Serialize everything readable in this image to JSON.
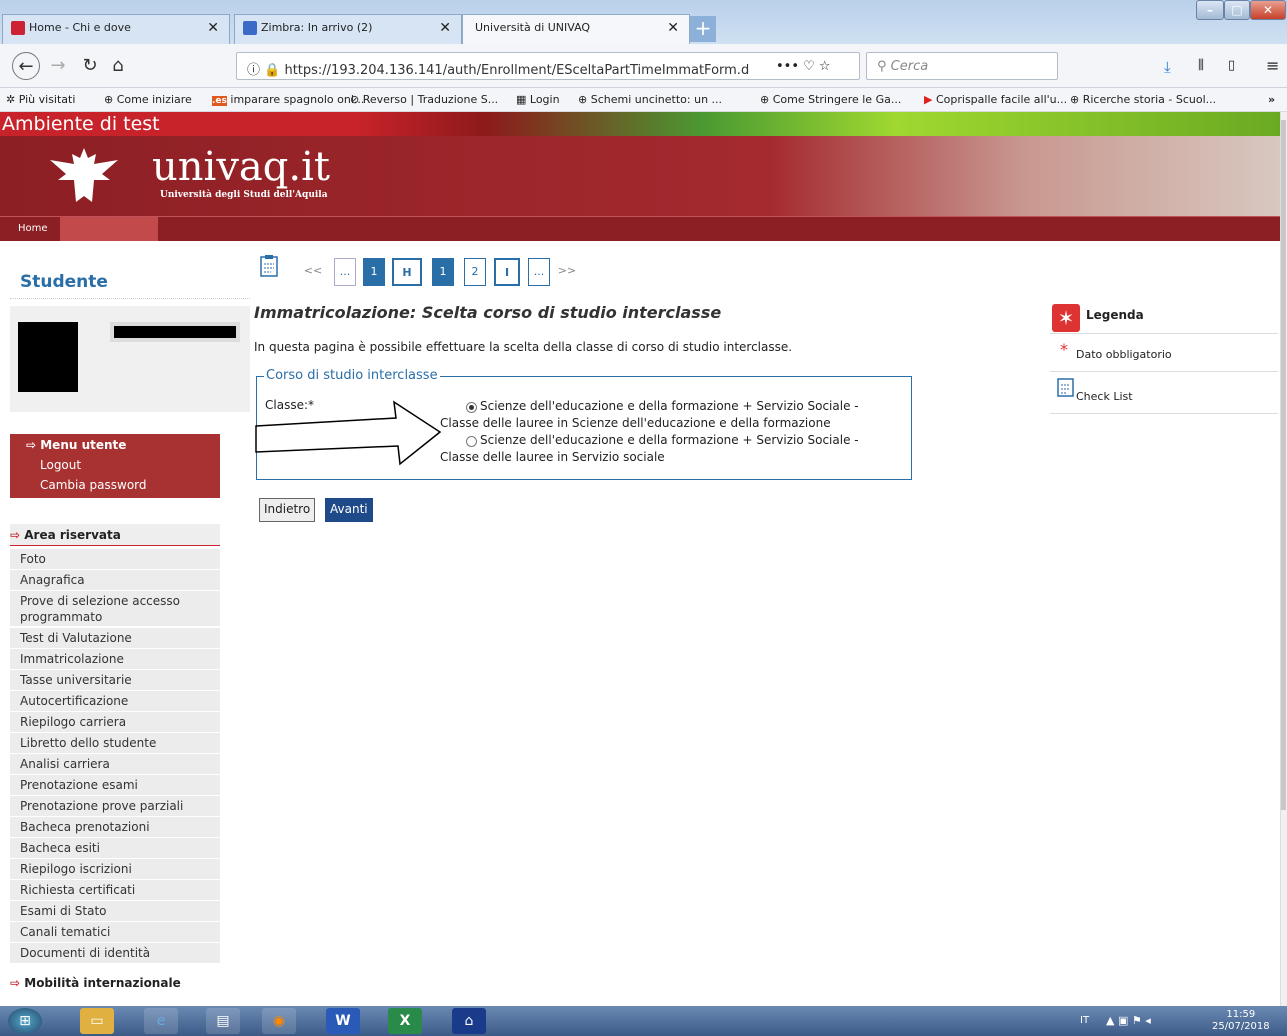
{
  "browser": {
    "tabs": [
      {
        "title": "Home - Chi e dove"
      },
      {
        "title": "Zimbra: In arrivo (2)"
      },
      {
        "title": "Università di UNIVAQ"
      }
    ],
    "url": "https://193.204.136.141/auth/Enrollment/ESceltaPartTimeImmatForm.d",
    "search_placeholder": "Cerca",
    "bookmarks": [
      "Più visitati",
      "Come iniziare",
      "imparare spagnolo onl...",
      "Reverso | Traduzione S...",
      "Login",
      "Schemi uncinetto: un ...",
      "Come Stringere le Ga...",
      "Coprispalle facile all'u...",
      "Ricerche storia - Scuol..."
    ]
  },
  "site": {
    "test_banner": "Ambiente di test",
    "logo": "univaq.it",
    "logo_sub": "Università degli Studi dell'Aquila",
    "home": "Home"
  },
  "sidebar": {
    "title": "Studente",
    "menu_head": "Menu utente",
    "menu": [
      "Logout",
      "Cambia password"
    ],
    "area_head": "Area riservata",
    "links": [
      "Foto",
      "Anagrafica",
      "Prove di selezione accesso programmato",
      "Test di Valutazione",
      "Immatricolazione",
      "Tasse universitarie",
      "Autocertificazione",
      "Riepilogo carriera",
      "Libretto dello studente",
      "Analisi carriera",
      "Prenotazione esami",
      "Prenotazione prove parziali",
      "Bacheca prenotazioni",
      "Bacheca esiti",
      "Riepilogo iscrizioni",
      "Richiesta certificati",
      "Esami di Stato",
      "Canali tematici",
      "Documenti di identità"
    ],
    "mobility_head": "Mobilità internazionale"
  },
  "main": {
    "pager": [
      "<<",
      "...",
      "1",
      "H",
      "1",
      "2",
      "I",
      "...",
      ">>"
    ],
    "title": "Immatricolazione: Scelta corso di studio interclasse",
    "description": "In questa pagina è possibile effettuare la scelta della classe di corso di studio interclasse.",
    "fieldset_legend": "Corso di studio interclasse",
    "class_label": "Classe:*",
    "options": [
      {
        "line1": "Scienze dell'educazione e della formazione + Servizio Sociale -",
        "line2": "Classe delle lauree in Scienze dell'educazione e della formazione",
        "selected": true
      },
      {
        "line1": "Scienze dell'educazione e della formazione + Servizio Sociale -",
        "line2": "Classe delle lauree in Servizio sociale",
        "selected": false
      }
    ],
    "btn_back": "Indietro",
    "btn_next": "Avanti"
  },
  "legenda": {
    "title": "Legenda",
    "items": [
      "Dato obbligatorio",
      "Check List"
    ]
  },
  "taskbar": {
    "lang": "IT",
    "time": "11:59",
    "date": "25/07/2018"
  },
  "colors": {
    "accent": "#2a6ea8",
    "brand": "#8c1f24"
  }
}
